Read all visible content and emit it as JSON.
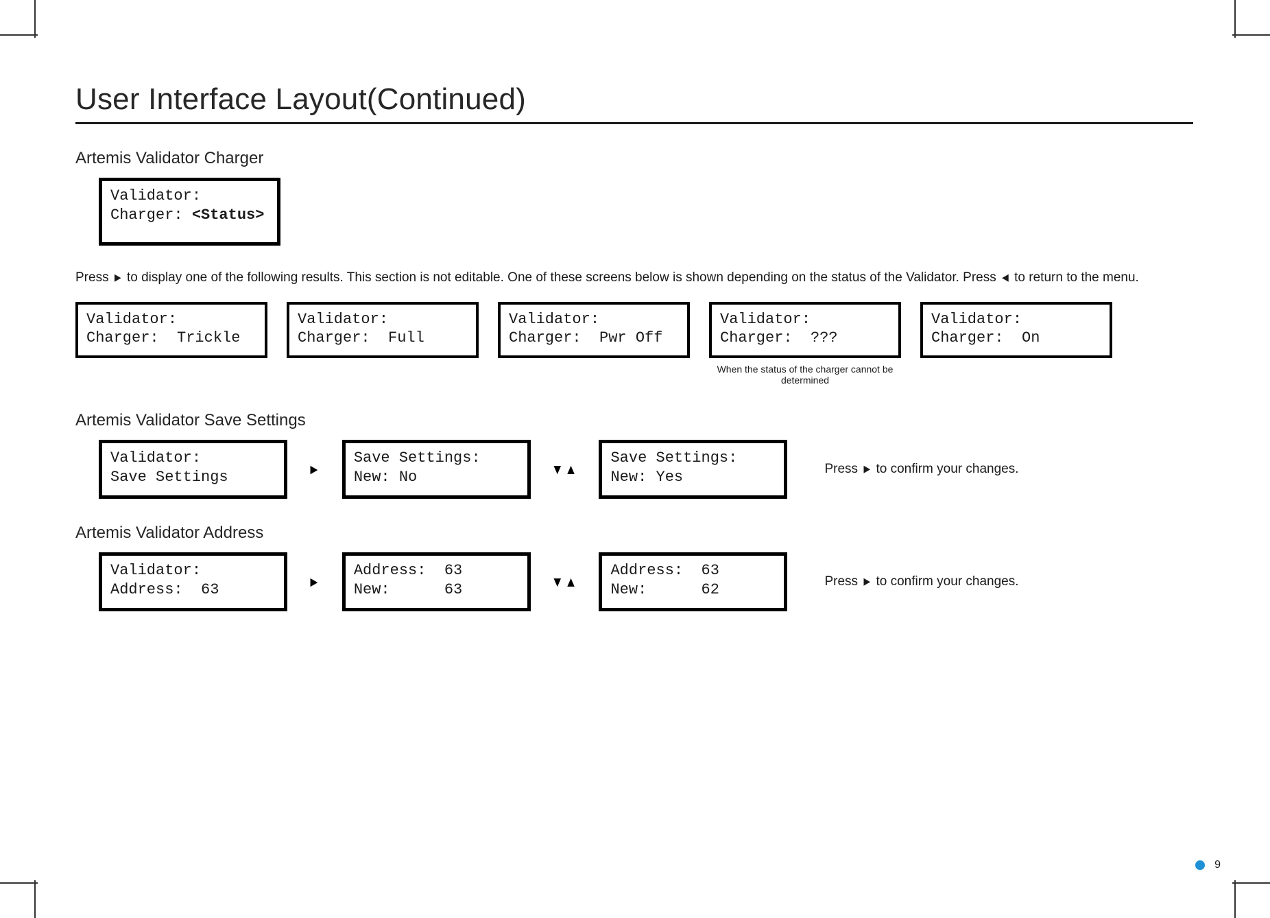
{
  "page": {
    "title": "User Interface Layout(Continued)",
    "number": "9"
  },
  "charger": {
    "heading": "Artemis Validator Charger",
    "id_box": {
      "line1": "Validator:",
      "line2_label": "Charger:",
      "line2_value": "<Status>"
    },
    "instruction_pre": "Press  ",
    "instruction_mid": " to display one of the following results. This section is not editable. One of these screens below is shown depending on the status of the Validator. Press ",
    "instruction_post": " to return to the menu.",
    "statuses": [
      {
        "line1": "Validator:",
        "line2": "Charger:  Trickle"
      },
      {
        "line1": "Validator:",
        "line2": "Charger:  Full"
      },
      {
        "line1": "Validator:",
        "line2": "Charger:  Pwr Off"
      },
      {
        "line1": "Validator:",
        "line2": "Charger:  ???",
        "note": "When the status of the charger cannot be determined"
      },
      {
        "line1": "Validator:",
        "line2": "Charger:  On"
      }
    ]
  },
  "save": {
    "heading": "Artemis Validator Save Settings",
    "box1": {
      "line1": "Validator:",
      "line2": "Save Settings"
    },
    "box2": {
      "line1": "Save Settings:",
      "line2": "New: No"
    },
    "box3": {
      "line1": "Save Settings:",
      "line2": "New: Yes"
    },
    "confirm_pre": "Press  ",
    "confirm_post": " to confirm your changes."
  },
  "address": {
    "heading": "Artemis Validator Address",
    "box1": {
      "line1": "Validator:",
      "line2": "Address:  63"
    },
    "box2": {
      "line1": "Address:  63",
      "line2": "New:      63"
    },
    "box3": {
      "line1": "Address:  63",
      "line2": "New:      62"
    },
    "confirm_pre": "Press  ",
    "confirm_post": " to confirm your changes."
  },
  "arrows": {
    "right": "►",
    "left": "◄",
    "down": "▼",
    "up": "▲"
  }
}
